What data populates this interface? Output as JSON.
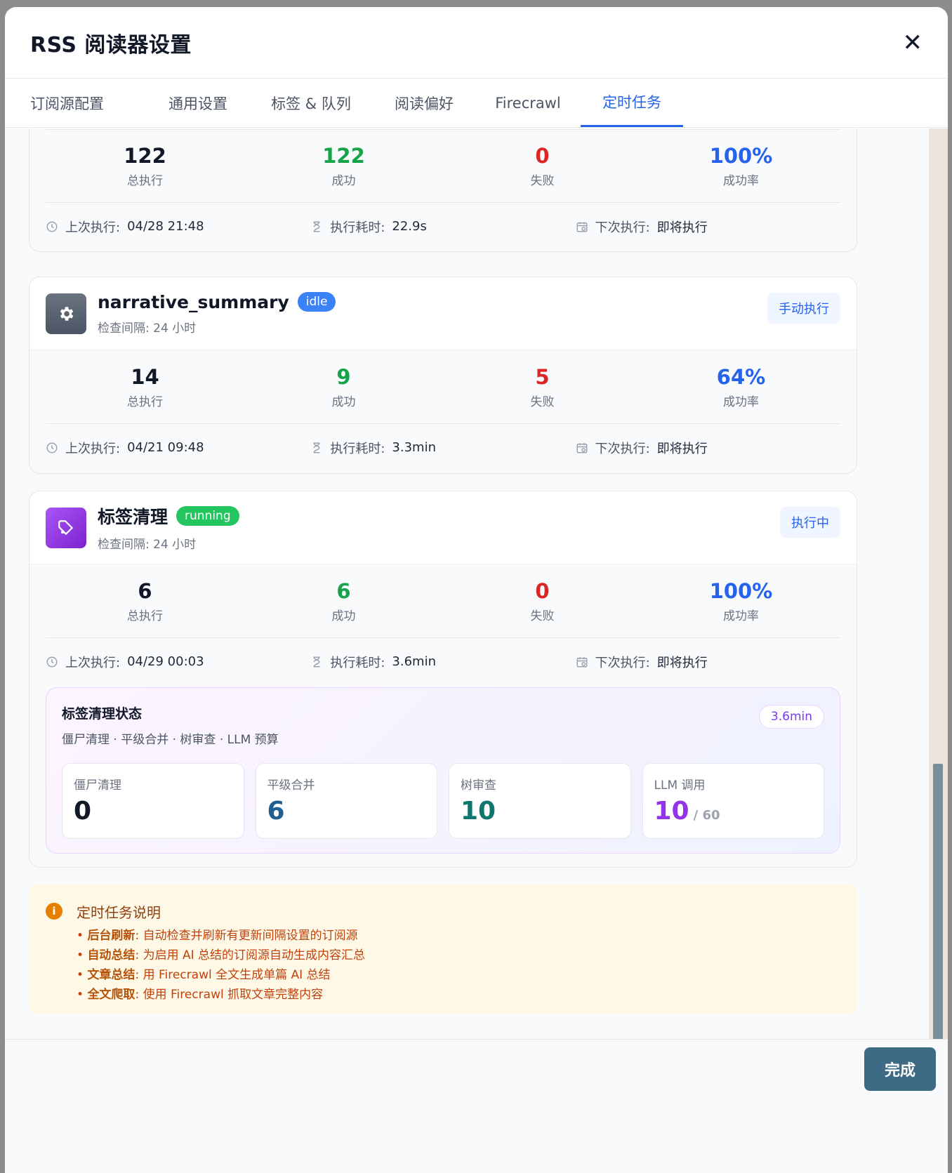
{
  "title": "RSS 阅读器设置",
  "tabs": [
    {
      "label": "订阅源配置"
    },
    {
      "label": "通用设置"
    },
    {
      "label": "标签 & 队列"
    },
    {
      "label": "阅读偏好"
    },
    {
      "label": "Firecrawl"
    },
    {
      "label": "定时任务"
    }
  ],
  "labels": {
    "total": "总执行",
    "success": "成功",
    "fail": "失败",
    "rate": "成功率",
    "last_run": "上次执行:",
    "duration": "执行耗时:",
    "next_run": "下次执行:"
  },
  "tasks": [
    {
      "total": "122",
      "success": "122",
      "fail": "0",
      "rate": "100%",
      "last_run": "04/28 21:48",
      "duration": "22.9s",
      "next_run": "即将执行"
    },
    {
      "name": "narrative_summary",
      "status": "idle",
      "interval": "检查间隔: 24 小时",
      "action": "手动执行",
      "total": "14",
      "success": "9",
      "fail": "5",
      "rate": "64%",
      "last_run": "04/21 09:48",
      "duration": "3.3min",
      "next_run": "即将执行"
    },
    {
      "name": "标签清理",
      "status": "running",
      "interval": "检查间隔: 24 小时",
      "action": "执行中",
      "total": "6",
      "success": "6",
      "fail": "0",
      "rate": "100%",
      "last_run": "04/29 00:03",
      "duration": "3.6min",
      "next_run": "即将执行"
    }
  ],
  "cleanup": {
    "title": "标签清理状态",
    "subtitle": "僵尸清理 · 平级合并 · 树审查 · LLM 预算",
    "time": "3.6min",
    "items": [
      {
        "label": "僵尸清理",
        "value": "0",
        "color": "#111827"
      },
      {
        "label": "平级合并",
        "value": "6",
        "color": "#1e6091"
      },
      {
        "label": "树审查",
        "value": "10",
        "color": "#0f766e"
      },
      {
        "label": "LLM 调用",
        "value": "10",
        "suffix": "/ 60",
        "color": "#9333ea"
      }
    ]
  },
  "notice": {
    "title": "定时任务说明",
    "items": [
      {
        "strong": "后台刷新",
        "text": ": 自动检查并刷新有更新间隔设置的订阅源"
      },
      {
        "strong": "自动总结",
        "text": ": 为启用 AI 总结的订阅源自动生成内容汇总"
      },
      {
        "strong": "文章总结",
        "text": ": 用 Firecrawl 全文生成单篇 AI 总结"
      },
      {
        "strong": "全文爬取",
        "text": ": 使用 Firecrawl 抓取文章完整内容"
      }
    ]
  },
  "footer": {
    "done": "完成"
  },
  "colors": {
    "accent": "#2563eb",
    "success": "#16a34a",
    "fail": "#dc2626",
    "idle_badge": "#3b82f6",
    "running_badge": "#22c55e",
    "done_button": "#3d6a85"
  },
  "icons": {
    "close": "close-icon",
    "gear": "gear-icon",
    "tag": "tag-icon",
    "clock": "clock-icon",
    "hourglass": "hourglass-icon",
    "calendar": "calendar-icon",
    "info": "info-icon"
  }
}
